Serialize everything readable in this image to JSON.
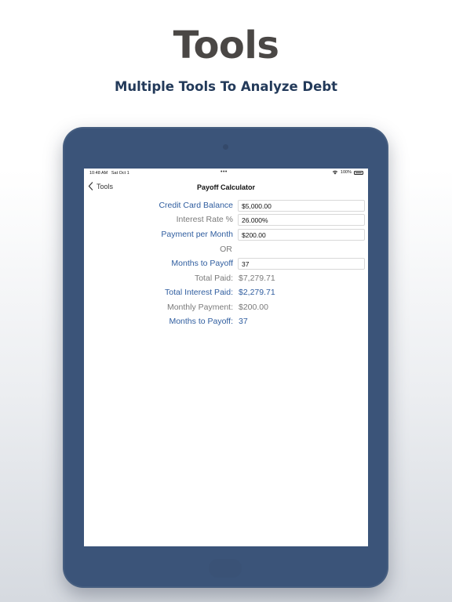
{
  "promo": {
    "title": "Tools",
    "subtitle": "Multiple Tools To Analyze Debt"
  },
  "status_bar": {
    "time": "10:48 AM",
    "date": "Sat Oct 1",
    "battery": "100%",
    "icons": [
      "wifi-icon",
      "battery-icon"
    ]
  },
  "nav": {
    "back_label": "Tools",
    "back_icon": "chevron-left-icon",
    "title": "Payoff Calculator"
  },
  "form": {
    "balance": {
      "label": "Credit Card Balance",
      "value": "$5,000.00"
    },
    "rate": {
      "label": "Interest Rate %",
      "value": "26.000%"
    },
    "payment": {
      "label": "Payment per Month",
      "value": "$200.00"
    },
    "or_label": "OR",
    "months": {
      "label": "Months to Payoff",
      "value": "37"
    }
  },
  "results": {
    "total_paid": {
      "label": "Total Paid:",
      "value": "$7,279.71"
    },
    "total_interest": {
      "label": "Total Interest Paid:",
      "value": "$2,279.71"
    },
    "monthly_payment": {
      "label": "Monthly Payment:",
      "value": "$200.00"
    },
    "months_to_payoff": {
      "label": "Months to Payoff:",
      "value": "37"
    }
  },
  "colors": {
    "accent_blue": "#2f5d9f",
    "muted_gray": "#7a7a7a",
    "device_frame": "#3b5479",
    "subtitle": "#233a5a"
  }
}
